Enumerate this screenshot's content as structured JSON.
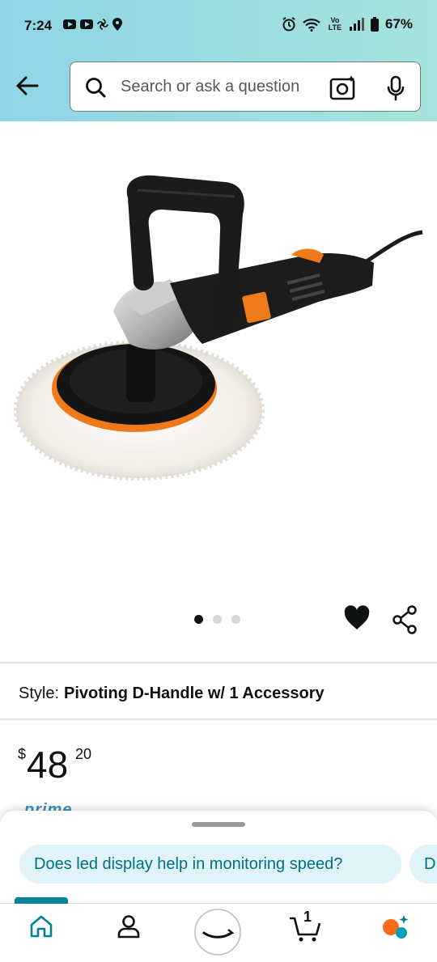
{
  "status_bar": {
    "time": "7:24",
    "battery": "67%",
    "network": "Vo LTE",
    "icons": [
      "youtube-icon",
      "youtube-icon",
      "fan-icon",
      "location-icon",
      "alarm-icon",
      "wifi-icon",
      "signal-icon",
      "battery-icon"
    ]
  },
  "search": {
    "placeholder": "Search or ask a question"
  },
  "gallery": {
    "image_count": 3,
    "active_index": 0
  },
  "style": {
    "label": "Style:",
    "value": "Pivoting D-Handle w/ 1 Accessory"
  },
  "price": {
    "currency": "$",
    "whole": "48",
    "fraction": "20"
  },
  "prime_peek": "prime",
  "suggestions": [
    "Does led display help in monitoring speed?",
    "D"
  ],
  "nav": {
    "cart_count": "1",
    "items": [
      "home-icon",
      "profile-icon",
      "menu-smile-icon",
      "cart-icon",
      "rufus-icon"
    ]
  },
  "colors": {
    "accent": "#008296",
    "chip_bg": "#dff3f8",
    "chip_text": "#007185",
    "header_gradient_start": "#8fd5e6",
    "header_gradient_end": "#a6e3dc"
  }
}
